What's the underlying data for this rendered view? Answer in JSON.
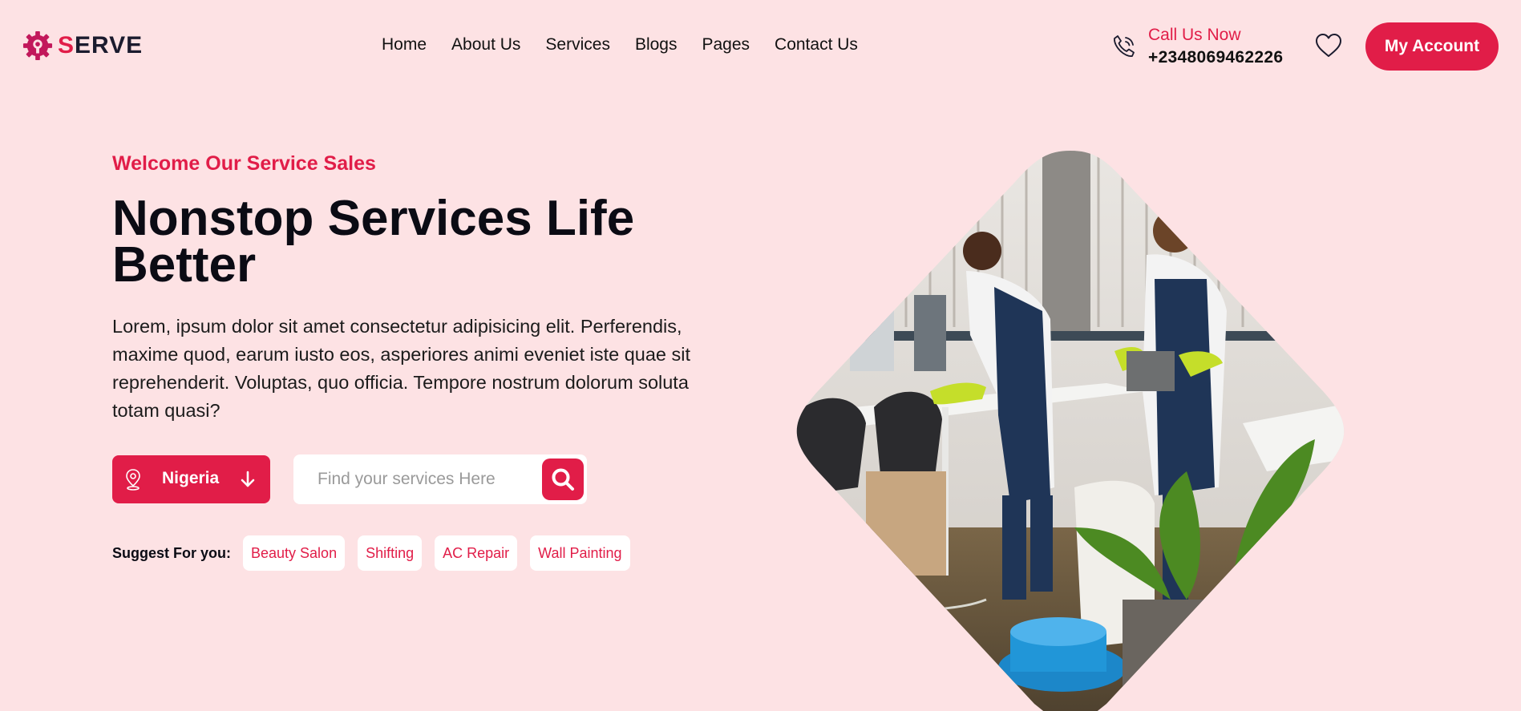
{
  "brand": {
    "logo_first": "S",
    "logo_rest": "ERVE"
  },
  "nav": {
    "items": [
      {
        "label": "Home"
      },
      {
        "label": "About Us"
      },
      {
        "label": "Services"
      },
      {
        "label": "Blogs"
      },
      {
        "label": "Pages"
      },
      {
        "label": "Contact Us"
      }
    ]
  },
  "contact": {
    "label": "Call Us Now",
    "phone": "+2348069462226"
  },
  "header": {
    "account_label": "My Account",
    "wishlist_icon": "heart-icon",
    "phone_icon": "phone-icon"
  },
  "hero": {
    "eyebrow": "Welcome Our Service Sales",
    "title": "Nonstop Services Life Better",
    "description": "Lorem, ipsum dolor sit amet consectetur adipisicing elit. Perferendis, maxime quod, earum iusto eos, asperiores animi eveniet iste quae sit reprehenderit. Voluptas, quo officia. Tempore nostrum dolorum soluta totam quasi?",
    "country_label": "Nigeria",
    "search_placeholder": "Find your services Here",
    "suggest_label": "Suggest For you:",
    "suggestions": [
      "Beauty Salon",
      "Shifting",
      "AC Repair",
      "Wall Painting"
    ]
  },
  "colors": {
    "accent": "#e11d48",
    "background": "#fde2e4",
    "text": "#0b0b14"
  }
}
